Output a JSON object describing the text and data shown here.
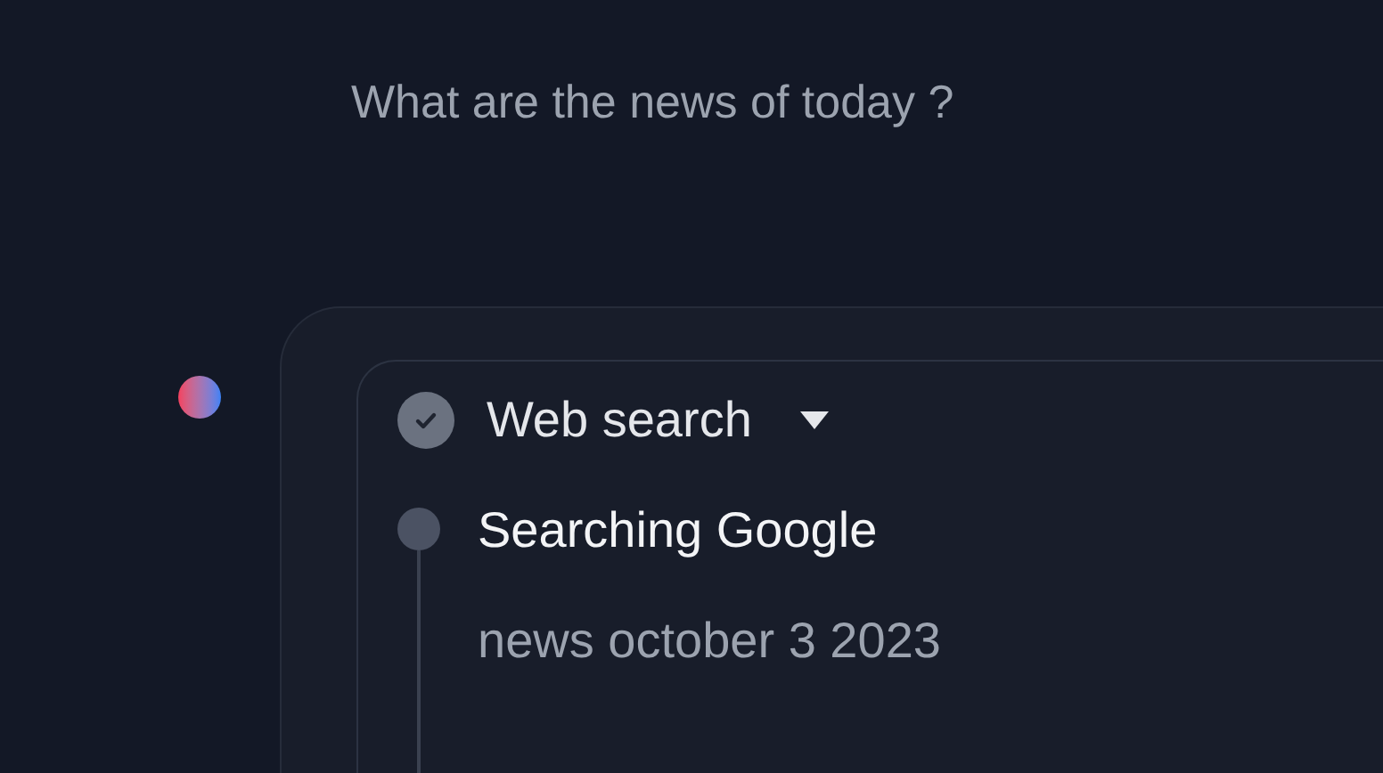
{
  "question": "What are the news of today ?",
  "tool_call": {
    "title": "Web search",
    "done": true,
    "expanded": true,
    "steps": [
      {
        "title": "Searching Google",
        "detail": "news october 3 2023"
      }
    ]
  }
}
